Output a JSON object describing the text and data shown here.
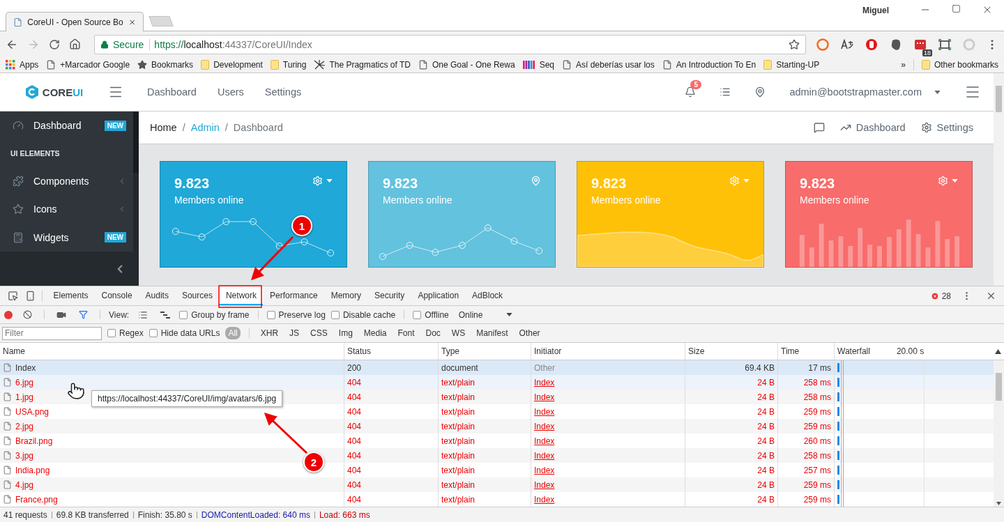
{
  "browser": {
    "tab_title": "CoreUI - Open Source Bo",
    "profile": "Miguel",
    "security": "Secure",
    "url": {
      "scheme": "https://",
      "host": "localhost",
      "path": ":44337/CoreUI/Index"
    },
    "extension_badge": "18",
    "bookmarks": [
      {
        "label": "Apps",
        "kind": "apps"
      },
      {
        "label": "+Marcador Google",
        "kind": "page"
      },
      {
        "label": "Bookmarks",
        "kind": "star"
      },
      {
        "label": "Development",
        "kind": "folder"
      },
      {
        "label": "Turing",
        "kind": "folder"
      },
      {
        "label": "The Pragmatics of TD",
        "kind": "spark"
      },
      {
        "label": "One Goal - One Rewa",
        "kind": "page"
      },
      {
        "label": "Seq",
        "kind": "bars"
      },
      {
        "label": "Así deberías usar los",
        "kind": "page"
      },
      {
        "label": "An Introduction To En",
        "kind": "page"
      },
      {
        "label": "Starting-UP",
        "kind": "folder"
      }
    ],
    "bookmarks_overflow": "»",
    "other_bookmarks": "Other bookmarks"
  },
  "app": {
    "logo": {
      "main": "CORE",
      "accent": "UI"
    },
    "nav": [
      "Dashboard",
      "Users",
      "Settings"
    ],
    "notifications": "5",
    "user": "admin@bootstrapmaster.com",
    "sidebar": [
      {
        "kind": "link",
        "label": "Dashboard",
        "badge": "NEW",
        "expandable": false
      },
      {
        "kind": "title",
        "label": "UI ELEMENTS"
      },
      {
        "kind": "link",
        "label": "Components",
        "expandable": true
      },
      {
        "kind": "link",
        "label": "Icons",
        "expandable": true
      },
      {
        "kind": "link",
        "label": "Widgets",
        "badge": "NEW",
        "expandable": false
      }
    ],
    "breadcrumb": [
      {
        "label": "Home",
        "kind": "text"
      },
      {
        "label": "Admin",
        "kind": "link",
        "separator": "/"
      },
      {
        "label": "Dashboard",
        "kind": "active",
        "separator": "/"
      }
    ],
    "breadcrumb_menu": [
      "Dashboard",
      "Settings"
    ],
    "cards": [
      {
        "value": "9.823",
        "label": "Members online",
        "color": "#20a8d8",
        "kind": "line"
      },
      {
        "value": "9.823",
        "label": "Members online",
        "color": "#63c2de",
        "kind": "points"
      },
      {
        "value": "9.823",
        "label": "Members online",
        "color": "#ffc107",
        "kind": "area"
      },
      {
        "value": "9.823",
        "label": "Members online",
        "color": "#f86c6b",
        "kind": "bars"
      }
    ]
  },
  "devtools": {
    "tabs": [
      {
        "label": "Elements",
        "selected": false
      },
      {
        "label": "Console",
        "selected": false
      },
      {
        "label": "Audits",
        "selected": false
      },
      {
        "label": "Sources",
        "selected": false
      },
      {
        "label": "Network",
        "selected": true
      },
      {
        "label": "Performance",
        "selected": false
      },
      {
        "label": "Memory",
        "selected": false
      },
      {
        "label": "Security",
        "selected": false
      },
      {
        "label": "Application",
        "selected": false
      },
      {
        "label": "AdBlock",
        "selected": false
      }
    ],
    "error_count": "28",
    "toolbar": {
      "recording": true,
      "filter_active": true,
      "view_label": "View:",
      "checkboxes": [
        {
          "label": "Group by frame",
          "checked": false
        },
        {
          "label": "Preserve log",
          "checked": false
        },
        {
          "label": "Disable cache",
          "checked": false
        },
        {
          "label": "Offline",
          "checked": false
        }
      ],
      "throttle": "Online"
    },
    "filter": {
      "placeholder": "Filter",
      "checkboxes": [
        {
          "label": "Regex",
          "checked": false
        },
        {
          "label": "Hide data URLs",
          "checked": false
        }
      ],
      "types": [
        {
          "label": "All",
          "selected": true
        },
        {
          "label": "XHR",
          "selected": false
        },
        {
          "label": "JS",
          "selected": false
        },
        {
          "label": "CSS",
          "selected": false
        },
        {
          "label": "Img",
          "selected": false
        },
        {
          "label": "Media",
          "selected": false
        },
        {
          "label": "Font",
          "selected": false
        },
        {
          "label": "Doc",
          "selected": false
        },
        {
          "label": "WS",
          "selected": false
        },
        {
          "label": "Manifest",
          "selected": false
        },
        {
          "label": "Other",
          "selected": false
        }
      ]
    },
    "table": {
      "columns": [
        "Name",
        "Status",
        "Type",
        "Initiator",
        "Size",
        "Time",
        "Waterfall"
      ],
      "waterfall_scale": "20.00 s",
      "rows": [
        {
          "name": "Index",
          "status": "200",
          "type": "document",
          "initiator": "Other",
          "size": "69.4 KB",
          "time": "17 ms",
          "error": false,
          "selected": true,
          "hovered": false
        },
        {
          "name": "6.jpg",
          "status": "404",
          "type": "text/plain",
          "initiator": "Index",
          "size": "24 B",
          "time": "258 ms",
          "error": true,
          "selected": false,
          "hovered": true
        },
        {
          "name": "1.jpg",
          "status": "404",
          "type": "text/plain",
          "initiator": "Index",
          "size": "24 B",
          "time": "258 ms",
          "error": true,
          "selected": false,
          "hovered": false
        },
        {
          "name": "USA.png",
          "status": "404",
          "type": "text/plain",
          "initiator": "Index",
          "size": "24 B",
          "time": "259 ms",
          "error": true,
          "selected": false,
          "hovered": false
        },
        {
          "name": "2.jpg",
          "status": "404",
          "type": "text/plain",
          "initiator": "Index",
          "size": "24 B",
          "time": "259 ms",
          "error": true,
          "selected": false,
          "hovered": false
        },
        {
          "name": "Brazil.png",
          "status": "404",
          "type": "text/plain",
          "initiator": "Index",
          "size": "24 B",
          "time": "260 ms",
          "error": true,
          "selected": false,
          "hovered": false
        },
        {
          "name": "3.jpg",
          "status": "404",
          "type": "text/plain",
          "initiator": "Index",
          "size": "24 B",
          "time": "258 ms",
          "error": true,
          "selected": false,
          "hovered": false
        },
        {
          "name": "India.png",
          "status": "404",
          "type": "text/plain",
          "initiator": "Index",
          "size": "24 B",
          "time": "257 ms",
          "error": true,
          "selected": false,
          "hovered": false
        },
        {
          "name": "4.jpg",
          "status": "404",
          "type": "text/plain",
          "initiator": "Index",
          "size": "24 B",
          "time": "259 ms",
          "error": true,
          "selected": false,
          "hovered": false
        },
        {
          "name": "France.png",
          "status": "404",
          "type": "text/plain",
          "initiator": "Index",
          "size": "24 B",
          "time": "259 ms",
          "error": true,
          "selected": false,
          "hovered": false
        }
      ]
    },
    "tooltip": "https://localhost:44337/CoreUI/img/avatars/6.jpg",
    "status_bar": [
      {
        "text": "41 requests",
        "kind": "plain"
      },
      {
        "text": "69.8 KB transferred",
        "kind": "plain"
      },
      {
        "text": "Finish: 35.80 s",
        "kind": "plain"
      },
      {
        "text": "DOMContentLoaded: 640 ms",
        "kind": "dom"
      },
      {
        "text": "Load: 663 ms",
        "kind": "load"
      }
    ]
  },
  "annotations": [
    {
      "label": "1"
    },
    {
      "label": "2"
    }
  ]
}
